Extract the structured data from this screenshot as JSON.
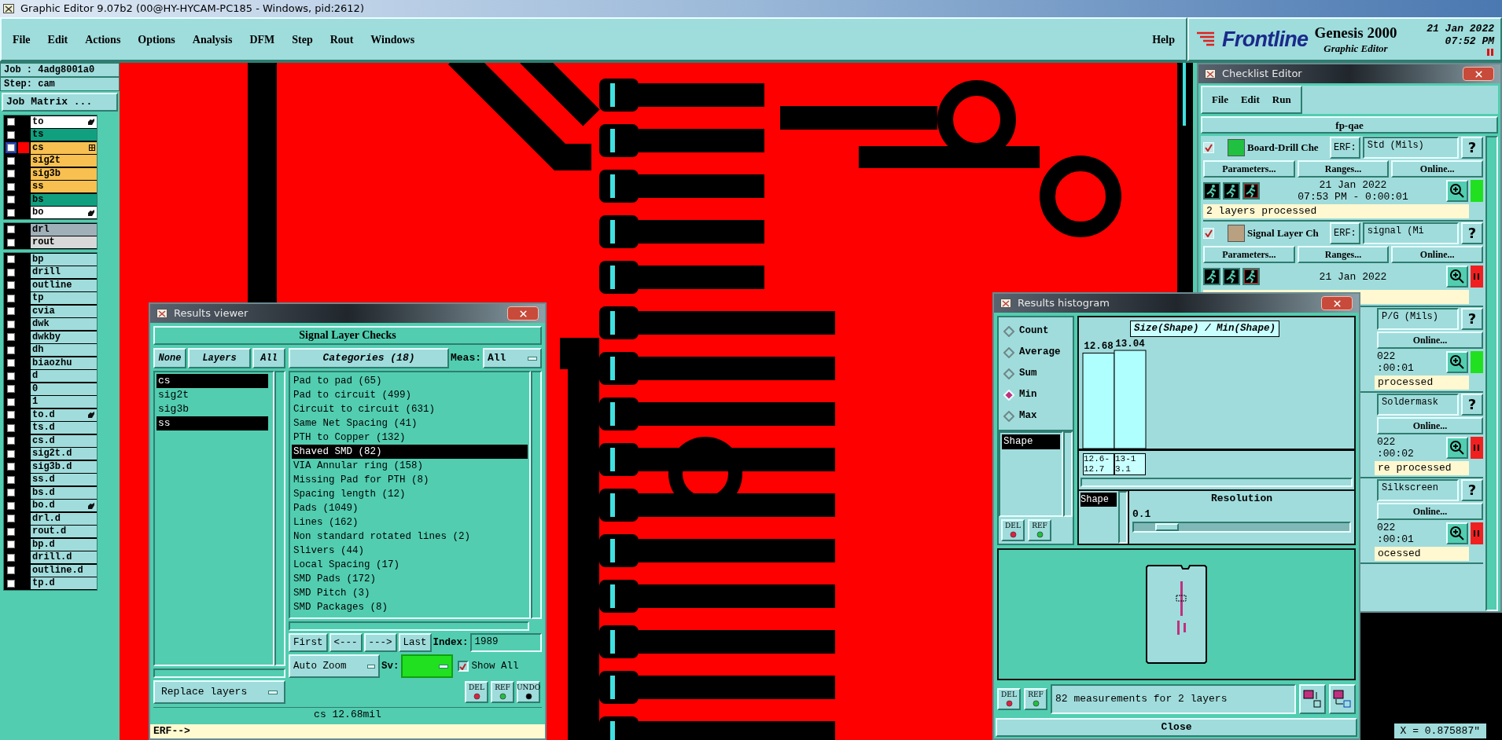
{
  "window": {
    "title": "Graphic Editor 9.07b2 (00@HY-HYCAM-PC185 - Windows, pid:2612)"
  },
  "menu": [
    "File",
    "Edit",
    "Actions",
    "Options",
    "Analysis",
    "DFM",
    "Step",
    "Rout",
    "Windows"
  ],
  "help": "Help",
  "brand": {
    "logo": "Frontline",
    "product": "Genesis 2000",
    "subtitle": "Graphic Editor",
    "date": "21 Jan 2022",
    "time": "07:52 PM"
  },
  "job": {
    "job": "Job : 4adg8001a0",
    "step": "Step: cam",
    "matrix_button": "Job Matrix ..."
  },
  "layer_groups": [
    [
      {
        "name": "to",
        "color": "#ffffff",
        "checked": false,
        "work": false,
        "flagged": true
      },
      {
        "name": "ts",
        "color": "#10a080",
        "checked": false,
        "work": false,
        "flagged": false
      },
      {
        "name": "cs",
        "color": "#f8c050",
        "checked": false,
        "work": true,
        "flagged": false
      },
      {
        "name": "sig2t",
        "color": "#f8c050",
        "checked": false,
        "work": false,
        "flagged": false
      },
      {
        "name": "sig3b",
        "color": "#f8c050",
        "checked": false,
        "work": false,
        "flagged": false
      },
      {
        "name": "ss",
        "color": "#f8c050",
        "checked": false,
        "work": false,
        "flagged": false
      },
      {
        "name": "bs",
        "color": "#10a080",
        "checked": false,
        "work": false,
        "flagged": false
      },
      {
        "name": "bo",
        "color": "#ffffff",
        "checked": false,
        "work": false,
        "flagged": true
      }
    ],
    [
      {
        "name": "drl",
        "color": "#a0b0b8",
        "checked": false,
        "work": false,
        "flagged": false
      },
      {
        "name": "rout",
        "color": "#d8d8d8",
        "checked": false,
        "work": false,
        "flagged": false
      }
    ],
    [
      {
        "name": "bp",
        "color": "#a0dcdc",
        "checked": false,
        "work": false,
        "flagged": false
      },
      {
        "name": "drill",
        "color": "#a0dcdc",
        "checked": false,
        "work": false,
        "flagged": false
      },
      {
        "name": "outline",
        "color": "#a0dcdc",
        "checked": false,
        "work": false,
        "flagged": false
      },
      {
        "name": "tp",
        "color": "#a0dcdc",
        "checked": false,
        "work": false,
        "flagged": false
      },
      {
        "name": "cvia",
        "color": "#a0dcdc",
        "checked": false,
        "work": false,
        "flagged": false
      },
      {
        "name": "dwk",
        "color": "#a0dcdc",
        "checked": false,
        "work": false,
        "flagged": false
      },
      {
        "name": "dwkby",
        "color": "#a0dcdc",
        "checked": false,
        "work": false,
        "flagged": false
      },
      {
        "name": "dh",
        "color": "#a0dcdc",
        "checked": false,
        "work": false,
        "flagged": false
      },
      {
        "name": "biaozhu",
        "color": "#a0dcdc",
        "checked": false,
        "work": false,
        "flagged": false
      },
      {
        "name": "d",
        "color": "#a0dcdc",
        "checked": false,
        "work": false,
        "flagged": false
      },
      {
        "name": "0",
        "color": "#a0dcdc",
        "checked": false,
        "work": false,
        "flagged": false
      },
      {
        "name": "1",
        "color": "#a0dcdc",
        "checked": false,
        "work": false,
        "flagged": false
      },
      {
        "name": "to.d",
        "color": "#a0dcdc",
        "checked": false,
        "work": false,
        "flagged": true
      },
      {
        "name": "ts.d",
        "color": "#a0dcdc",
        "checked": false,
        "work": false,
        "flagged": false
      },
      {
        "name": "cs.d",
        "color": "#a0dcdc",
        "checked": false,
        "work": false,
        "flagged": false
      },
      {
        "name": "sig2t.d",
        "color": "#a0dcdc",
        "checked": false,
        "work": false,
        "flagged": false
      },
      {
        "name": "sig3b.d",
        "color": "#a0dcdc",
        "checked": false,
        "work": false,
        "flagged": false
      },
      {
        "name": "ss.d",
        "color": "#a0dcdc",
        "checked": false,
        "work": false,
        "flagged": false
      },
      {
        "name": "bs.d",
        "color": "#a0dcdc",
        "checked": false,
        "work": false,
        "flagged": false
      },
      {
        "name": "bo.d",
        "color": "#a0dcdc",
        "checked": false,
        "work": false,
        "flagged": true
      },
      {
        "name": "drl.d",
        "color": "#a0dcdc",
        "checked": false,
        "work": false,
        "flagged": false
      },
      {
        "name": "rout.d",
        "color": "#a0dcdc",
        "checked": false,
        "work": false,
        "flagged": false
      },
      {
        "name": "bp.d",
        "color": "#a0dcdc",
        "checked": false,
        "work": false,
        "flagged": false
      },
      {
        "name": "drill.d",
        "color": "#a0dcdc",
        "checked": false,
        "work": false,
        "flagged": false
      },
      {
        "name": "outline.d",
        "color": "#a0dcdc",
        "checked": false,
        "work": false,
        "flagged": false
      },
      {
        "name": "tp.d",
        "color": "#a0dcdc",
        "checked": false,
        "work": false,
        "flagged": false
      }
    ]
  ],
  "canvas": {
    "coordinate": "X = 0.875887\""
  },
  "results_viewer": {
    "title": "Results viewer",
    "header": "Signal Layer Checks",
    "layer_buttons": [
      "None",
      "Layers",
      "All"
    ],
    "categories_button": "Categories (18)",
    "meas_label": "Meas:",
    "meas_value": "All",
    "layers": [
      {
        "name": "cs",
        "selected": true
      },
      {
        "name": "sig2t",
        "selected": false
      },
      {
        "name": "sig3b",
        "selected": false
      },
      {
        "name": "ss",
        "selected": true
      }
    ],
    "categories": [
      {
        "name": "Pad to pad (65)",
        "selected": false
      },
      {
        "name": "Pad to circuit (499)",
        "selected": false
      },
      {
        "name": "Circuit to circuit (631)",
        "selected": false
      },
      {
        "name": "Same Net Spacing (41)",
        "selected": false
      },
      {
        "name": "PTH to Copper (132)",
        "selected": false
      },
      {
        "name": "Shaved SMD (82)",
        "selected": true
      },
      {
        "name": "VIA Annular ring (158)",
        "selected": false
      },
      {
        "name": "Missing Pad for PTH (8)",
        "selected": false
      },
      {
        "name": "Spacing length (12)",
        "selected": false
      },
      {
        "name": "Pads (1049)",
        "selected": false
      },
      {
        "name": "Lines (162)",
        "selected": false
      },
      {
        "name": "Non standard rotated lines (2)",
        "selected": false
      },
      {
        "name": "Slivers (44)",
        "selected": false
      },
      {
        "name": "Local Spacing (17)",
        "selected": false
      },
      {
        "name": "SMD Pads (172)",
        "selected": false
      },
      {
        "name": "SMD Pitch (3)",
        "selected": false
      },
      {
        "name": "SMD Packages (8)",
        "selected": false
      }
    ],
    "nav": [
      "First",
      "<---",
      "--->",
      "Last"
    ],
    "index_label": "Index:",
    "index_value": "1989",
    "zoom_mode": "Auto Zoom",
    "sv_label": "Sv:",
    "show_all": {
      "label": "Show All",
      "checked": true
    },
    "actions": [
      "DEL",
      "REF",
      "UNDO"
    ],
    "replace": "Replace layers",
    "status": "cs 12.68mil",
    "erf": "ERF-->"
  },
  "histogram": {
    "title": "Results histogram",
    "modes": [
      {
        "label": "Count",
        "selected": false
      },
      {
        "label": "Average",
        "selected": false
      },
      {
        "label": "Sum",
        "selected": false
      },
      {
        "label": "Min",
        "selected": true
      },
      {
        "label": "Max",
        "selected": false
      }
    ],
    "attributes": [
      {
        "name": "Shape",
        "selected": true
      }
    ],
    "chart_data": {
      "type": "bar",
      "title": "Size(Shape) / Min(Shape)",
      "categories": [
        "12.6-12.7",
        "13-13.1"
      ],
      "values": [
        12.68,
        13.04
      ],
      "data_labels": true
    },
    "sort_attributes": [
      {
        "name": "Shape",
        "selected": true
      }
    ],
    "resolution_label": "Resolution",
    "resolution_value": "0.1",
    "resolution": {
      "level": 0.1
    },
    "list_buttons": [
      "DEL",
      "REF"
    ],
    "buttons": [
      "DEL",
      "REF"
    ],
    "summary": "82 measurements for 2 layers",
    "close": "Close"
  },
  "checklist": {
    "title": "Checklist Editor",
    "menu": [
      "File",
      "Edit",
      "Run"
    ],
    "name": "fp-qae",
    "items": [
      {
        "checked": true,
        "name": "Board-Drill Che",
        "erf": "ERF:",
        "filter": "Std (Mils)",
        "help": "?",
        "buttons": [
          "Parameters...",
          "Ranges...",
          "Online..."
        ],
        "date": "21 Jan 2022",
        "time": "07:53 PM - 0:00:01",
        "color": "#20e020",
        "message": "2 layers processed"
      },
      {
        "checked": true,
        "name": "Signal Layer Ch",
        "erf": "ERF:",
        "filter": "signal (Mi",
        "help": "?",
        "buttons": [
          "Parameters...",
          "Ranges...",
          "Online..."
        ],
        "date": "21 Jan 2022",
        "color": "#f02020"
      },
      {
        "filter": "P/G (Mils)",
        "help": "?",
        "buttons": [
          "Online..."
        ],
        "date": "022",
        "time": ":00:01",
        "color": "#20e020",
        "message": "processed"
      },
      {
        "filter": "Soldermask",
        "help": "?",
        "buttons": [
          "Online..."
        ],
        "date": "022",
        "time": ":00:02",
        "color": "#f02020",
        "message": "re processed"
      },
      {
        "filter": "Silkscreen",
        "help": "?",
        "buttons": [
          "Online..."
        ],
        "date": "022",
        "time": ":00:01",
        "color": "#f02020",
        "message": "ocessed"
      }
    ]
  }
}
